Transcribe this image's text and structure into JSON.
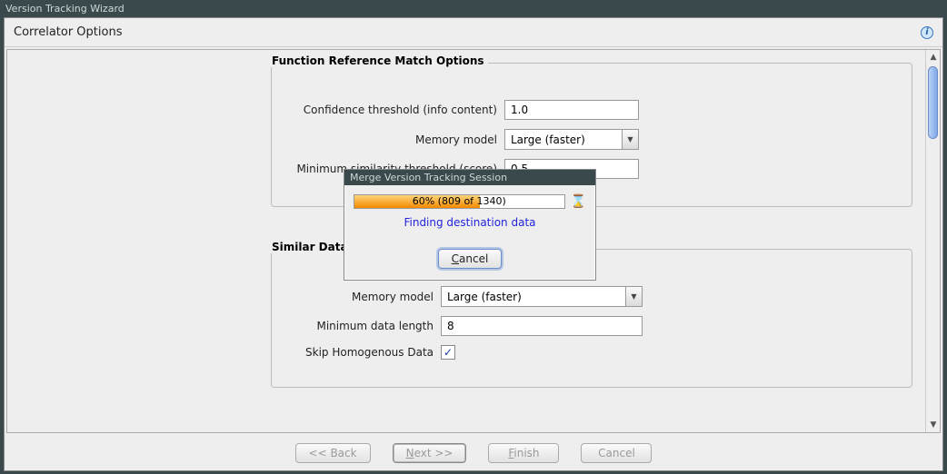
{
  "window": {
    "title": "Version Tracking Wizard"
  },
  "header": {
    "title": "Correlator Options"
  },
  "group1": {
    "legend": "Function Reference Match Options",
    "confidence_label": "Confidence threshold (info content)",
    "confidence_value": "1.0",
    "memory_label": "Memory model",
    "memory_value": "Large (faster)",
    "minsim_label": "Minimum similarity threshold (score)",
    "minsim_value": "0.5"
  },
  "group2": {
    "legend": "Similar Data Match Options",
    "memory_label": "Memory model",
    "memory_value": "Large (faster)",
    "minlen_label": "Minimum data length",
    "minlen_value": "8",
    "skip_label": "Skip Homogenous Data",
    "skip_checked": true
  },
  "buttons": {
    "back": "<< Back",
    "next": "Next >>",
    "finish": "Finish",
    "cancel": "Cancel"
  },
  "modal": {
    "title": "Merge Version Tracking Session",
    "progress_text": "60% (809 of 1340)",
    "progress_percent": 60,
    "status": "Finding destination data",
    "cancel": "Cancel"
  }
}
